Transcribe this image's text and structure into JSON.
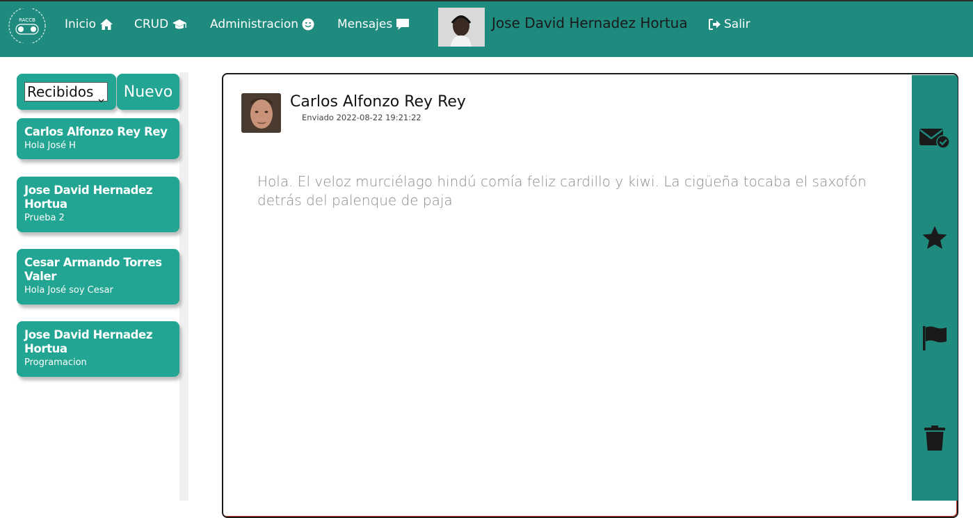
{
  "header": {
    "logo_text": "RACCB",
    "nav": [
      {
        "label": "Inicio",
        "icon": "home-icon"
      },
      {
        "label": "CRUD",
        "icon": "graduation-cap-icon"
      },
      {
        "label": "Administracion",
        "icon": "smile-icon"
      },
      {
        "label": "Mensajes",
        "icon": "comment-icon"
      }
    ],
    "user_name": "Jose David Hernadez Hortua",
    "logout_label": "Salir",
    "logout_icon": "sign-out-icon"
  },
  "sidebar": {
    "folder_selected": "Recibidos",
    "new_label": "Nuevo",
    "messages": [
      {
        "sender": "Carlos Alfonzo Rey Rey",
        "preview": "Hola José H"
      },
      {
        "sender": "Jose David Hernadez Hortua",
        "preview": "Prueba 2"
      },
      {
        "sender": "Cesar Armando Torres Valer",
        "preview": "Hola José soy Cesar"
      },
      {
        "sender": "Jose David Hernadez Hortua",
        "preview": "Programacion"
      }
    ]
  },
  "message": {
    "sender": "Carlos Alfonzo Rey Rey",
    "sent": "Enviado 2022-08-22 19:21:22",
    "body": "Hola. El veloz murciélago hindú comía feliz cardillo y kiwi. La cigüeña tocaba el saxofón detrás del palenque de paja"
  },
  "actions": [
    "mark-read-icon",
    "star-icon",
    "flag-icon",
    "trash-icon"
  ],
  "colors": {
    "primary": "#1f8a7e",
    "card": "#22a592",
    "body_text": "#8a8a8a"
  }
}
